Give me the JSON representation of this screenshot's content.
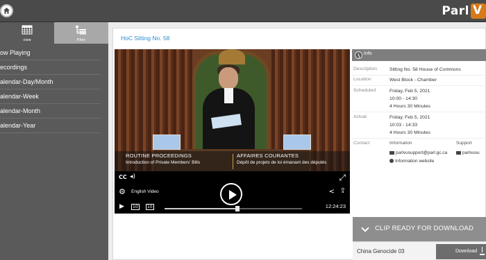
{
  "header": {
    "logo_text": "Parl",
    "logo_badge": "V",
    "home_icon": "home-icon"
  },
  "sidebar": {
    "tabs": [
      {
        "label": "view",
        "icon": "calendar-grid-icon"
      },
      {
        "label": "Filter",
        "icon": "filter-list-icon"
      }
    ],
    "items": [
      {
        "label": "ow Playing"
      },
      {
        "label": "ecordings"
      },
      {
        "label": "alendar-Day/Month"
      },
      {
        "label": "alendar-Week"
      },
      {
        "label": "alendar-Month"
      },
      {
        "label": "alendar-Year"
      }
    ]
  },
  "panel": {
    "title": "HoC Sitting No. 58"
  },
  "video": {
    "lower_third": {
      "en_title": "ROUTINE PROCEEDINGS",
      "en_sub": "Introduction of Private Members' Bills",
      "fr_title": "AFFAIRES COURANTES",
      "fr_sub": "Dépôt de projets de loi émanant des députés"
    },
    "cc_label": "CC",
    "language": "English Video",
    "rewind_label": "10",
    "forward_label": "10",
    "time": "12:24:23",
    "progress": 0.53
  },
  "info": {
    "title": "Info",
    "description_label": "Description",
    "description": "Sitting No. 58 House of Commons",
    "location_label": "Location",
    "location": "West Block - Chamber",
    "scheduled_label": "Scheduled",
    "scheduled_date": "Friday, Feb 5, 2021",
    "scheduled_time": "10:00 - 14:30",
    "scheduled_duration": "4 Hours 30 Minutes",
    "actual_label": "Actual",
    "actual_date": "Friday, Feb 5, 2021",
    "actual_time": "10:03 - 14:33",
    "actual_duration": "4 Hours 30 Minutes",
    "contact_label": "Contact",
    "info_col_head": "Information",
    "support_col_head": "Support",
    "info_email": "parlvusupport@parl.gc.ca",
    "support_email": "parlvusu",
    "website": "Information website"
  },
  "clip": {
    "title": "CLIP READY FOR DOWNLOAD",
    "name": "China Genocide 03",
    "download_label": "Download"
  }
}
